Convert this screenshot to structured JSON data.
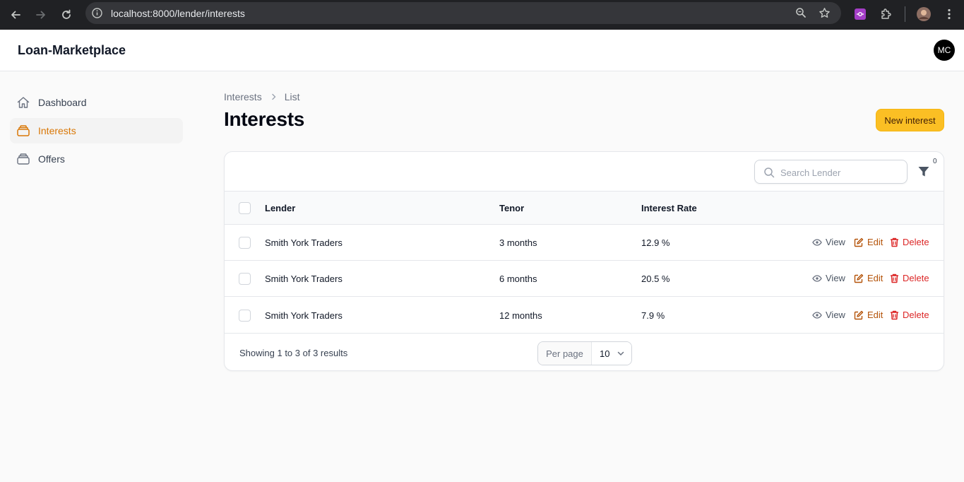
{
  "browser": {
    "url": "localhost:8000/lender/interests"
  },
  "app": {
    "brand": "Loan-Marketplace",
    "avatar_initials": "MC",
    "accent_color": "#d97706",
    "button_color": "#fbbf24"
  },
  "sidebar": {
    "items": [
      {
        "label": "Dashboard",
        "icon": "home-icon",
        "active": false
      },
      {
        "label": "Interests",
        "icon": "stack-icon",
        "active": true
      },
      {
        "label": "Offers",
        "icon": "stack-icon",
        "active": false
      }
    ]
  },
  "breadcrumb": {
    "items": [
      "Interests",
      "List"
    ]
  },
  "page": {
    "title": "Interests",
    "new_button": "New interest"
  },
  "table": {
    "search_placeholder": "Search Lender",
    "filter_count": "0",
    "columns": [
      "Lender",
      "Tenor",
      "Interest Rate"
    ],
    "rows": [
      {
        "lender": "Smith York Traders",
        "tenor": "3 months",
        "rate": "12.9 %"
      },
      {
        "lender": "Smith York Traders",
        "tenor": "6 months",
        "rate": "20.5 %"
      },
      {
        "lender": "Smith York Traders",
        "tenor": "12 months",
        "rate": "7.9 %"
      }
    ],
    "actions": {
      "view": "View",
      "edit": "Edit",
      "delete": "Delete"
    },
    "footer": {
      "showing": "Showing 1 to 3 of 3 results",
      "per_page_label": "Per page",
      "per_page_value": "10"
    }
  }
}
